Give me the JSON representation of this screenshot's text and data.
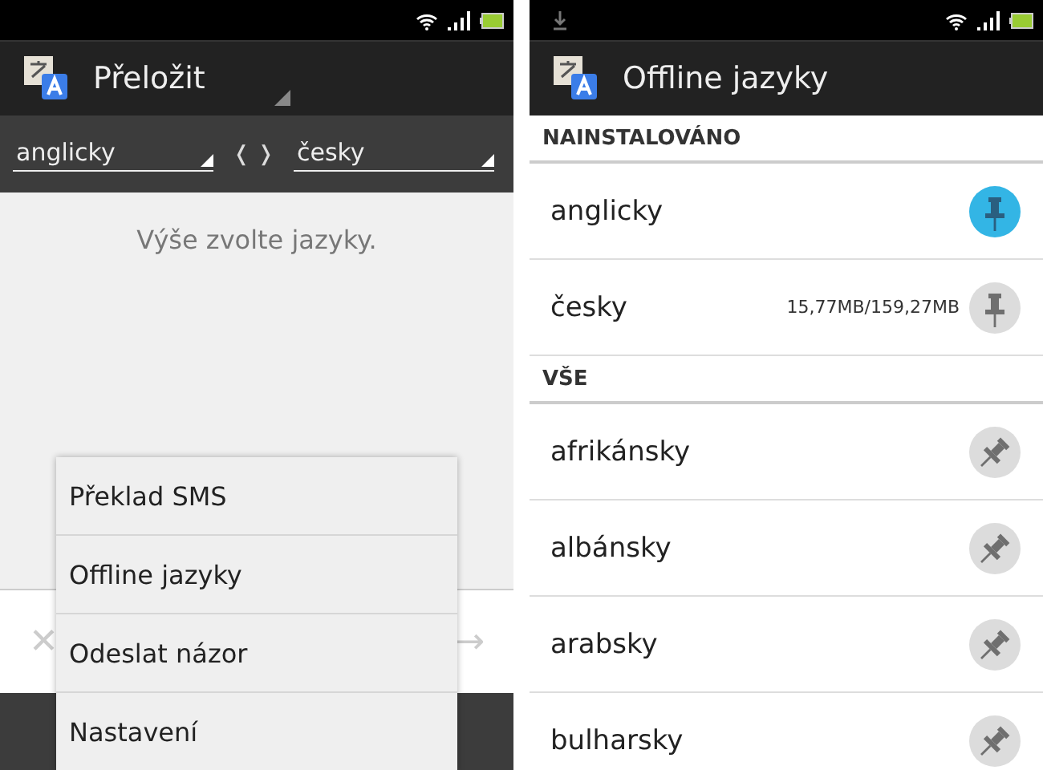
{
  "translate_screen": {
    "title": "Přeložit",
    "source_language": "anglicky",
    "target_language": "česky",
    "swap_label": "❬ ❭",
    "hint": "Výše zvolte jazyky.",
    "clear_symbol": "✕",
    "go_symbol": "→",
    "menu": [
      "Překlad SMS",
      "Offline jazyky",
      "Odeslat názor",
      "Nastavení"
    ]
  },
  "offline_screen": {
    "title": "Offline jazyky",
    "sections": [
      {
        "header": "NAINSTALOVÁNO",
        "items": [
          {
            "name": "anglicky",
            "kind": "pinned"
          },
          {
            "name": "česky",
            "size": "15,77MB/159,27MB",
            "kind": "downloaded"
          }
        ]
      },
      {
        "header": "VŠE",
        "items": [
          {
            "name": "afrikánsky",
            "kind": "available"
          },
          {
            "name": "albánsky",
            "kind": "available"
          },
          {
            "name": "arabsky",
            "kind": "available"
          },
          {
            "name": "bulharsky",
            "kind": "available"
          }
        ]
      }
    ]
  }
}
